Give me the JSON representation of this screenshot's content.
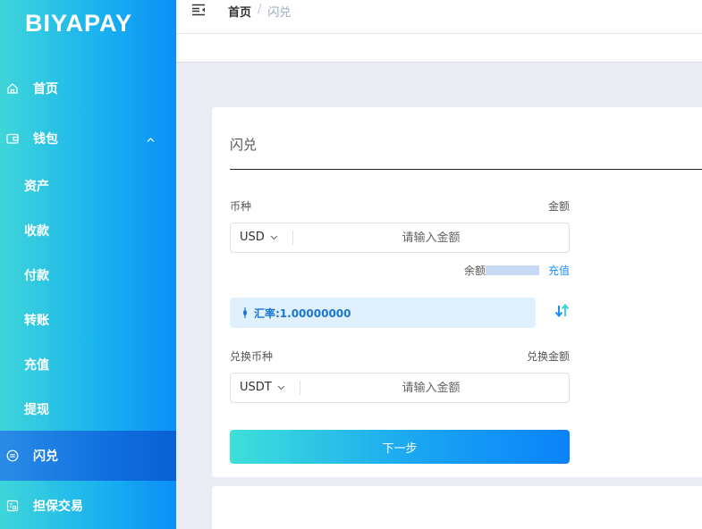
{
  "brand": {
    "logo": "BIYAPAY"
  },
  "sidebar": {
    "items": [
      {
        "label": "首页",
        "icon": "home-icon"
      },
      {
        "label": "钱包",
        "icon": "wallet-icon",
        "expanded": true
      },
      {
        "label": "闪兑",
        "icon": "exchange-icon",
        "active": true
      },
      {
        "label": "担保交易",
        "icon": "guarantee-icon"
      }
    ],
    "wallet_sub": [
      "资产",
      "收款",
      "付款",
      "转账",
      "充值",
      "提现"
    ]
  },
  "header": {
    "breadcrumb": {
      "home": "首页",
      "separator": "/",
      "current": "闪兑"
    }
  },
  "form": {
    "title": "闪兑",
    "from": {
      "currency_label": "币种",
      "amount_label": "金额",
      "currency": "USD",
      "placeholder": "请输入金额"
    },
    "balance_label": "余额",
    "recharge_label": "充值",
    "rate_text": "汇率:1.00000000",
    "to": {
      "currency_label": "兑换币种",
      "amount_label": "兑换金额",
      "currency": "USDT",
      "placeholder": "请输入金额"
    },
    "next_button": "下一步"
  },
  "colors": {
    "accent": "#1890ff",
    "sidebar_gradient_start": "#3fd6d9",
    "sidebar_gradient_end": "#0b8ff8",
    "active_item": "#1070e0",
    "rate_bg": "#e1f0fd"
  }
}
